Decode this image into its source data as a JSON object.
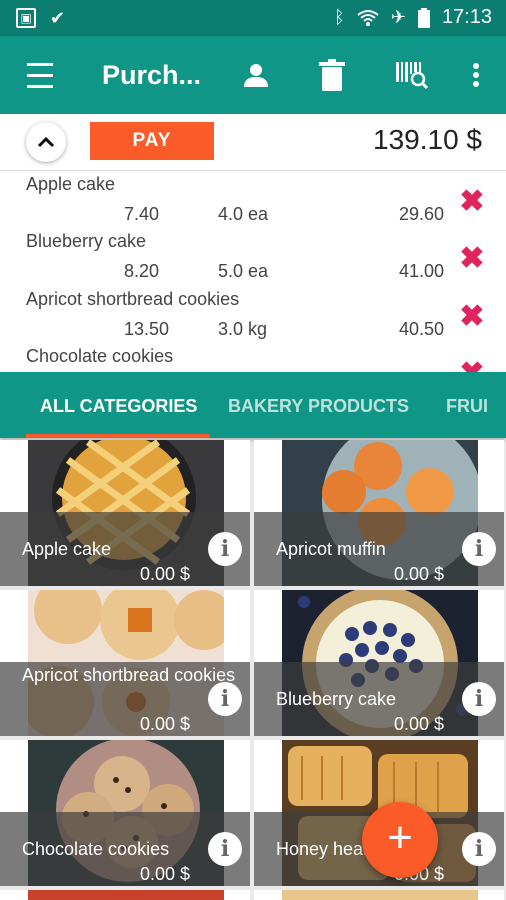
{
  "status_bar": {
    "time": "17:13",
    "left_icons": [
      "gallery-icon",
      "check-notification-icon"
    ],
    "right_icons": [
      "bluetooth-icon",
      "wifi-icon",
      "airplane-icon",
      "battery-icon"
    ]
  },
  "toolbar": {
    "title": "Purch...",
    "icons": [
      "menu-icon",
      "person-icon",
      "trash-icon",
      "barcode-scan-icon",
      "more-vert-icon"
    ]
  },
  "cart": {
    "pay_label": "PAY",
    "total": "139.10 $",
    "items": [
      {
        "name": "Apple cake",
        "price": "7.40",
        "qty": "4.0 ea",
        "sum": "29.60"
      },
      {
        "name": "Blueberry cake",
        "price": "8.20",
        "qty": "5.0 ea",
        "sum": "41.00"
      },
      {
        "name": "Apricot shortbread cookies",
        "price": "13.50",
        "qty": "3.0 kg",
        "sum": "40.50"
      },
      {
        "name": "Chocolate cookies",
        "price": "",
        "qty": "",
        "sum": ""
      }
    ]
  },
  "tabs": [
    {
      "label": "ALL CATEGORIES",
      "active": true
    },
    {
      "label": "BAKERY PRODUCTS",
      "active": false
    },
    {
      "label": "FRUI",
      "active": false
    }
  ],
  "products": [
    {
      "name": "Apple cake",
      "price": "0.00 $"
    },
    {
      "name": "Apricot muffin",
      "price": "0.00 $"
    },
    {
      "name": "Apricot shortbread cookies",
      "price": "0.00 $"
    },
    {
      "name": "Blueberry cake",
      "price": "0.00 $"
    },
    {
      "name": "Chocolate cookies",
      "price": "0.00 $"
    },
    {
      "name": "Honey hear",
      "price": "0.00 $"
    }
  ],
  "fab_label": "+",
  "colors": {
    "primary": "#0f9686",
    "primary_dark": "#0b7d71",
    "accent": "#fb5a29",
    "remove": "#e0245e"
  }
}
